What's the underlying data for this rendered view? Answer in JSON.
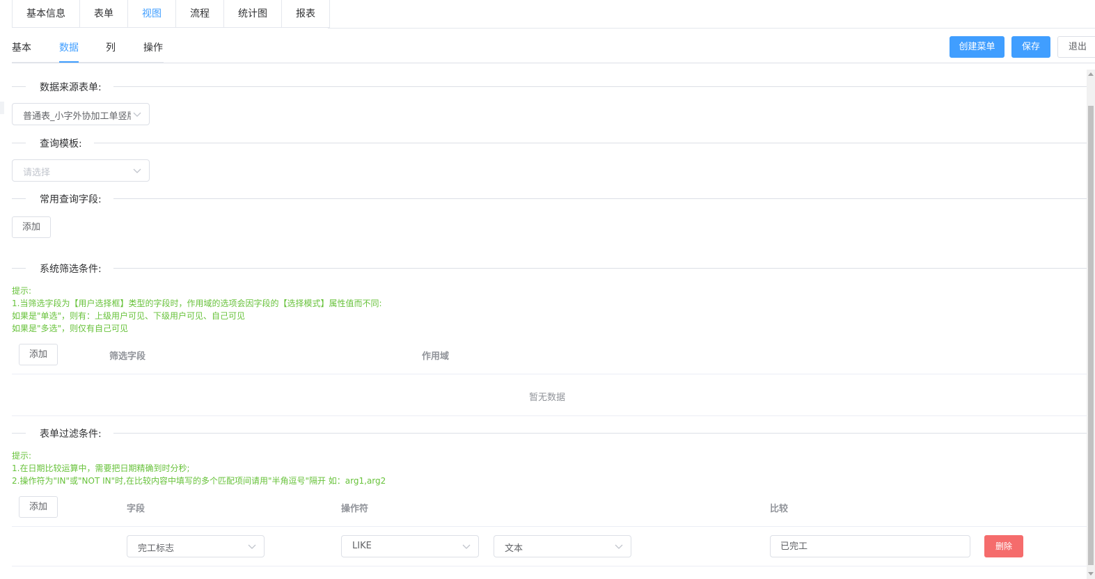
{
  "top_tabs": [
    "基本信息",
    "表单",
    "视图",
    "流程",
    "统计图",
    "报表"
  ],
  "top_tab_active": "视图",
  "sub_tabs": [
    "基本",
    "数据",
    "列",
    "操作"
  ],
  "sub_tab_active": "数据",
  "toolbar": {
    "create_menu": "创建菜单",
    "save": "保存",
    "exit": "退出"
  },
  "data_source": {
    "title": "数据来源表单:",
    "value": "普通表_小字外协加工单竖版"
  },
  "query_template": {
    "title": "查询模板:",
    "placeholder": "请选择"
  },
  "common_fields": {
    "title": "常用查询字段:",
    "add": "添加"
  },
  "system_filter": {
    "title": "系统筛选条件:",
    "tips": [
      "提示:",
      "1.当筛选字段为【用户选择框】类型的字段时，作用域的选项会因字段的【选择模式】属性值而不同:",
      "如果是\"单选\"，则有：上级用户可见、下级用户可见、自己可见",
      "如果是\"多选\"，则仅有自己可见"
    ],
    "add": "添加",
    "columns": [
      "筛选字段",
      "作用域"
    ],
    "empty": "暂无数据"
  },
  "form_filter": {
    "title": "表单过滤条件:",
    "tips": [
      "提示:",
      "1.在日期比较运算中，需要把日期精确到时分秒;",
      "2.操作符为\"IN\"或\"NOT IN\"时,在比较内容中填写的多个匹配项间请用\"半角逗号\"隔开 如：arg1,arg2"
    ],
    "add": "添加",
    "columns": [
      "字段",
      "操作符",
      "比较"
    ],
    "row": {
      "field": "完工标志",
      "operator": "LIKE",
      "type": "文本",
      "compare": "已完工",
      "delete": "删除"
    }
  },
  "icons": {
    "select_arrow": "chevron-down-icon"
  },
  "colors": {
    "primary": "#409eff",
    "danger": "#f56c6c",
    "tip": "#67c23a"
  }
}
